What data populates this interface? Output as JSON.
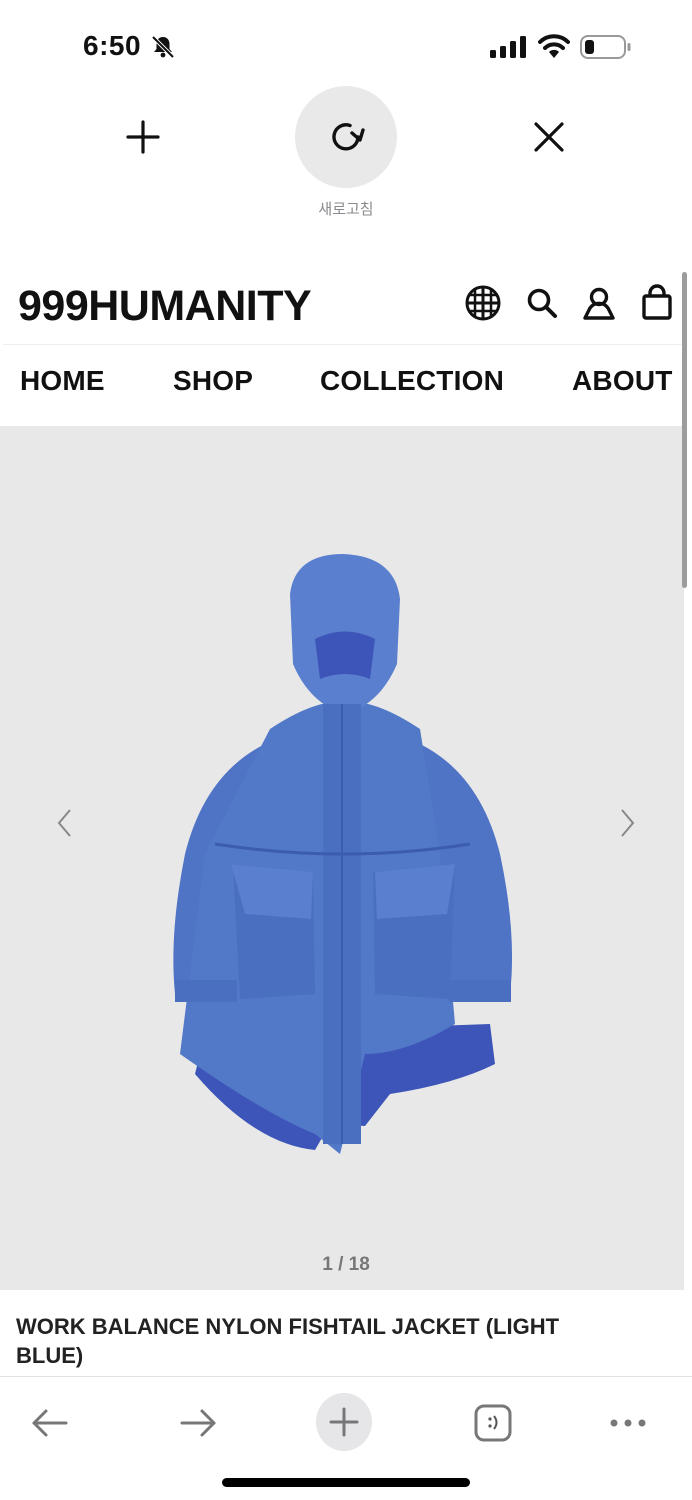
{
  "status_bar": {
    "time": "6:50"
  },
  "controls": {
    "refresh_label": "새로고침"
  },
  "site": {
    "logo": "999HUMANITY",
    "nav": [
      "HOME",
      "SHOP",
      "COLLECTION",
      "ABOUT"
    ]
  },
  "gallery": {
    "counter": "1 / 18"
  },
  "product": {
    "title": "WORK BALANCE NYLON FISHTAIL JACKET (LIGHT BLUE)"
  },
  "colors": {
    "jacket": "#5278c8",
    "gallery_bg": "#e8e8e8"
  }
}
